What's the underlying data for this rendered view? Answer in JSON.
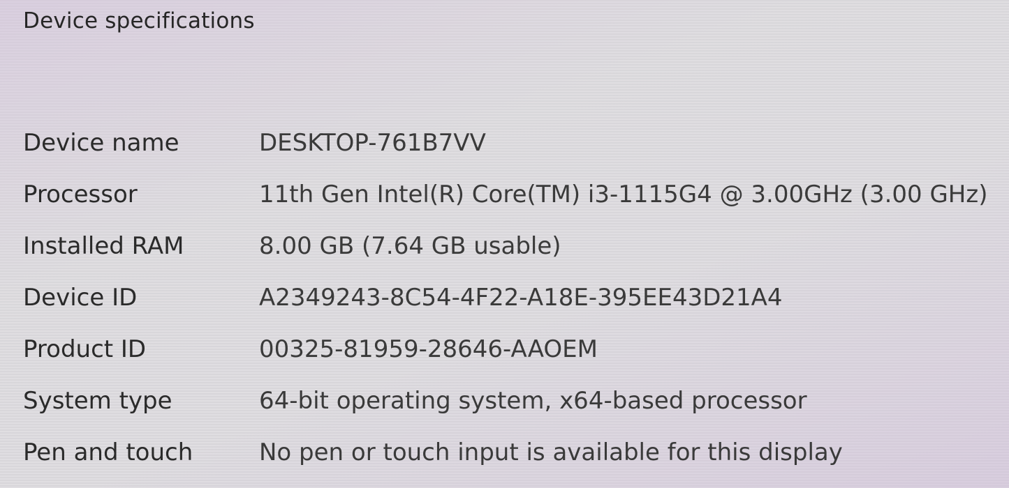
{
  "section": {
    "title": "Device specifications"
  },
  "specs": [
    {
      "label": "Device name",
      "value": "DESKTOP-761B7VV"
    },
    {
      "label": "Processor",
      "value": "11th Gen Intel(R) Core(TM) i3-1115G4 @ 3.00GHz (3.00 GHz)"
    },
    {
      "label": "Installed RAM",
      "value": "8.00 GB (7.64 GB usable)"
    },
    {
      "label": "Device ID",
      "value": "A2349243-8C54-4F22-A18E-395EE43D21A4"
    },
    {
      "label": "Product ID",
      "value": "00325-81959-28646-AAOEM"
    },
    {
      "label": "System type",
      "value": "64-bit operating system, x64-based processor"
    },
    {
      "label": "Pen and touch",
      "value": "No pen or touch input is available for this display"
    }
  ]
}
